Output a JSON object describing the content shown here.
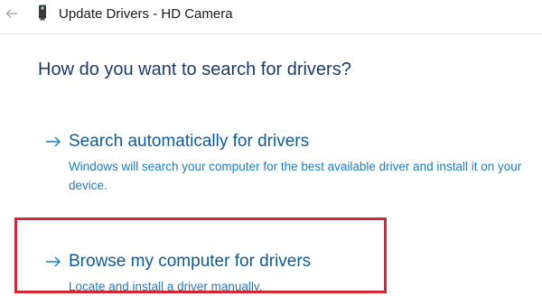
{
  "window": {
    "title": "Update Drivers - HD Camera"
  },
  "icons": {
    "back": "back-arrow-icon",
    "device": "camera-device-icon",
    "option_arrow": "right-arrow-icon"
  },
  "question": "How do you want to search for drivers?",
  "options": [
    {
      "title": "Search automatically for drivers",
      "description": "Windows will search your computer for the best available driver and install it on your device."
    },
    {
      "title": "Browse my computer for drivers",
      "description": "Locate and install a driver manually."
    }
  ],
  "colors": {
    "question": "#1b3a6b",
    "option_title": "#0e5a96",
    "option_description": "#1e7bbd",
    "highlight": "#d32634"
  }
}
